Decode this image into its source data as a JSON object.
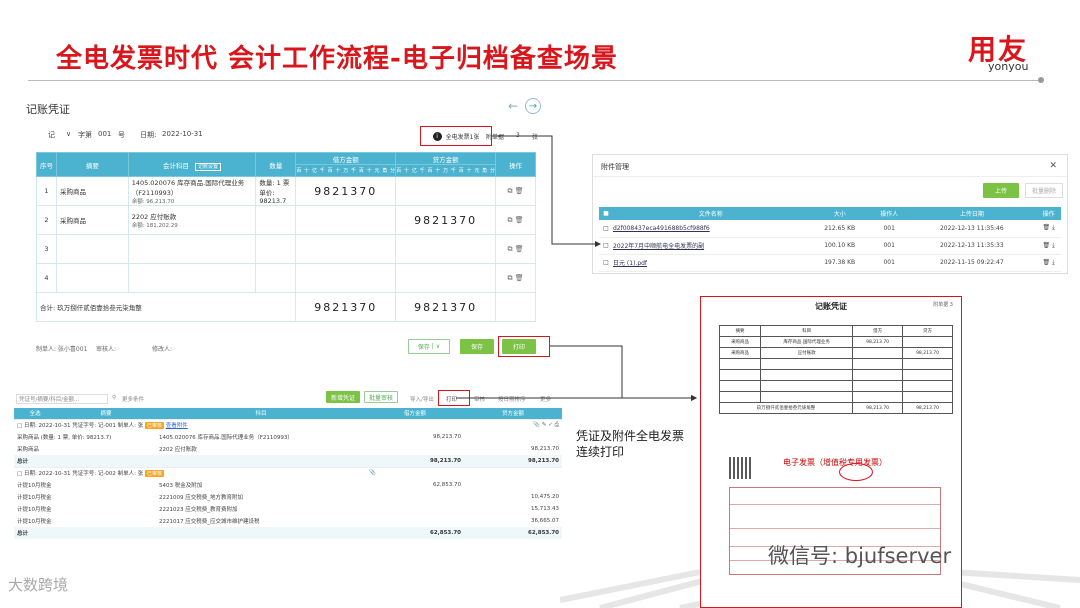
{
  "slide": {
    "title": "全电发票时代 会计工作流程-电子归档备查场景",
    "logo_main": "用友",
    "logo_sub": "yonyou",
    "caption_line1": "凭证及附件全电发票",
    "caption_line2": "连续打印",
    "watermark_wechat": "微信号: bjufserver",
    "watermark_bottom": "大数跨境",
    "accent_color": "#d8161b"
  },
  "voucher": {
    "title": "记账凭证",
    "prev_icon": "arrow-left-icon",
    "next_icon": "arrow-right-icon",
    "word": "记",
    "word_label": "字第",
    "number": "001",
    "number_label": "号",
    "date_label": "日期:",
    "date": "2022-10-31",
    "e_invoice_label": "全电发票1张",
    "attach_label": "附单据",
    "attach_count": "3",
    "attach_unit": "张",
    "columns": [
      "序号",
      "摘要",
      "会计科目",
      "数量",
      "借方金额",
      "贷方金额",
      "操作"
    ],
    "subject_settings": "记账设置",
    "digit_headers": [
      "百",
      "十",
      "亿",
      "千",
      "百",
      "十",
      "万",
      "千",
      "百",
      "十",
      "元",
      "角",
      "分"
    ],
    "rows": [
      {
        "no": "1",
        "summary": "采购商品",
        "subject": "1405.020076 库存商品.国际代理业务（F2110993）",
        "balance_label": "余额:",
        "balance": "96,213.70",
        "qty": "数量: 1 票",
        "price": "单价: 98213.7",
        "debit": "9821370",
        "credit": ""
      },
      {
        "no": "2",
        "summary": "采购商品",
        "subject": "2202 应付账款",
        "balance_label": "余额:",
        "balance": "181,202.29",
        "qty": "",
        "price": "",
        "debit": "",
        "credit": "9821370"
      },
      {
        "no": "3",
        "summary": "",
        "subject": "",
        "balance_label": "",
        "balance": "",
        "qty": "",
        "price": "",
        "debit": "",
        "credit": ""
      },
      {
        "no": "4",
        "summary": "",
        "subject": "",
        "balance_label": "",
        "balance": "",
        "qty": "",
        "price": "",
        "debit": "",
        "credit": ""
      }
    ],
    "total_label": "合计: 玖万捌仟贰佰壹拾叁元柒角整",
    "total_debit": "9821370",
    "total_credit": "9821370",
    "maker": "制单人: 张小喜001",
    "reviewer": "审核人:",
    "bookkeeper": "修改人:",
    "btn_save_draft": "保存",
    "btn_save": "保存",
    "btn_print": "打印"
  },
  "attachments": {
    "title": "附件管理",
    "upload": "上传",
    "batch_delete": "批量删除",
    "columns": [
      "文件名称",
      "大小",
      "操作人",
      "上传日期",
      "操作"
    ],
    "files": [
      {
        "name": "d2f008437eca491688b5cf988f6",
        "size": "212.65 KB",
        "user": "001",
        "date": "2022-12-13 11:35:46"
      },
      {
        "name": "2022年7月中顺航电全电发票的副",
        "size": "100.10 KB",
        "user": "001",
        "date": "2022-12-13 11:35:33"
      },
      {
        "name": "日元 (1).pdf",
        "size": "197.38 KB",
        "user": "001",
        "date": "2022-11-15 09:22:47"
      }
    ]
  },
  "list": {
    "search_placeholder": "凭证号/摘要/科目/金额...",
    "filter": "更多条件",
    "btn_new": "新增凭证",
    "btn_batch": "批量审核",
    "btn_import": "导入/导出",
    "btn_print": "打印",
    "btn_review": "审核",
    "btn_sort": "按日期排序",
    "btn_more": "更多",
    "columns": [
      "全选",
      "摘要",
      "科目",
      "借方金额",
      "贷方金额"
    ],
    "groups": [
      {
        "header": "日期: 2022-10-31  凭证字号: 记-001  制单人: 张",
        "tag": "已审核",
        "link": "查看附件",
        "lines": [
          {
            "summary": "采购商品 (数量: 1 票, 单价: 98213.7)",
            "subject": "1405.020076 库存商品.国际代理业务（F2110993）",
            "debit": "98,213.70",
            "credit": ""
          },
          {
            "summary": "采购商品",
            "subject": "2202 应付账款",
            "debit": "",
            "credit": "98,213.70"
          }
        ],
        "total_label": "总计",
        "total_debit": "98,213.70",
        "total_credit": "98,213.70"
      },
      {
        "header": "日期: 2022-10-31  凭证字号: 记-002  制单人: 张",
        "tag": "已审核",
        "link": "",
        "lines": [
          {
            "summary": "计提10月税金",
            "subject": "5403 税金及附加",
            "debit": "62,853.70",
            "credit": ""
          },
          {
            "summary": "计提10月税金",
            "subject": "2221009 应交税费_地方教育附加",
            "debit": "",
            "credit": "10,475.20"
          },
          {
            "summary": "计提10月税金",
            "subject": "2221023 应交税费_教育费附加",
            "debit": "",
            "credit": "15,713.43"
          },
          {
            "summary": "计提10月税金",
            "subject": "2221017 应交税费_应交城市维护建设税",
            "debit": "",
            "credit": "36,665.07"
          }
        ],
        "total_label": "总计",
        "total_debit": "62,853.70",
        "total_credit": "62,853.70"
      }
    ]
  },
  "printed": {
    "title": "记账凭证",
    "page": "附单据 3",
    "columns": [
      "摘要",
      "科目",
      "借方",
      "贷方"
    ],
    "rows": [
      {
        "summary": "采购商品",
        "subject": "库存商品.国际代理业务",
        "debit": "98,213.70",
        "credit": ""
      },
      {
        "summary": "采购商品",
        "subject": "应付账款",
        "debit": "",
        "credit": "98,213.70"
      }
    ],
    "total": "玖万捌仟贰佰壹拾叁元柒角整",
    "invoice_title": "电子发票（增值税专用发票）"
  }
}
